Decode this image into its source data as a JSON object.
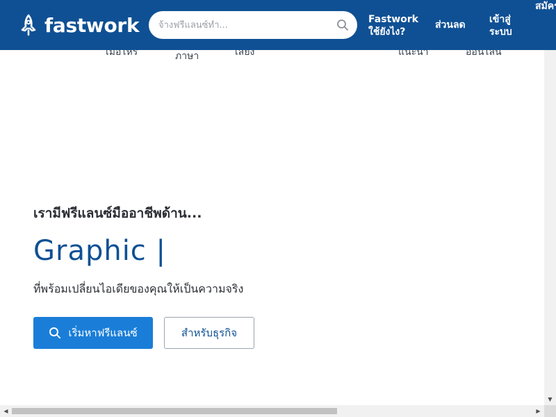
{
  "header": {
    "brand": "fastwork",
    "search": {
      "placeholder": "จ้างฟรีแลนซ์ทำ...",
      "value": ""
    },
    "nav": {
      "how_to": "Fastwork ใช้ยังไง?",
      "discount": "ส่วนลด",
      "login": "เข้าสู่ ระบบ",
      "signup": "สมัคร เป็น ฟรี แลน"
    },
    "brand_color": "#0f5094"
  },
  "subnav": [
    "เมื่อไหร่",
    "ภาษา",
    "เสียง",
    "แนะนำ",
    "ออนไลน์"
  ],
  "hero": {
    "intro": "เรามีฟรีแลนซ์มืออาชีพด้าน...",
    "skill": "Graphic |",
    "subtitle": "ที่พร้อมเปลี่ยนไอเดียของคุณให้เป็นความจริง",
    "primary_button": "เริ่มหาฟรีแลนซ์",
    "secondary_button": "สำหรับธุรกิจ",
    "accent_color": "#1a7ed8"
  },
  "icons": {
    "logo": "fastwork-logo-icon",
    "search": "search-icon",
    "button_search": "search-icon"
  }
}
